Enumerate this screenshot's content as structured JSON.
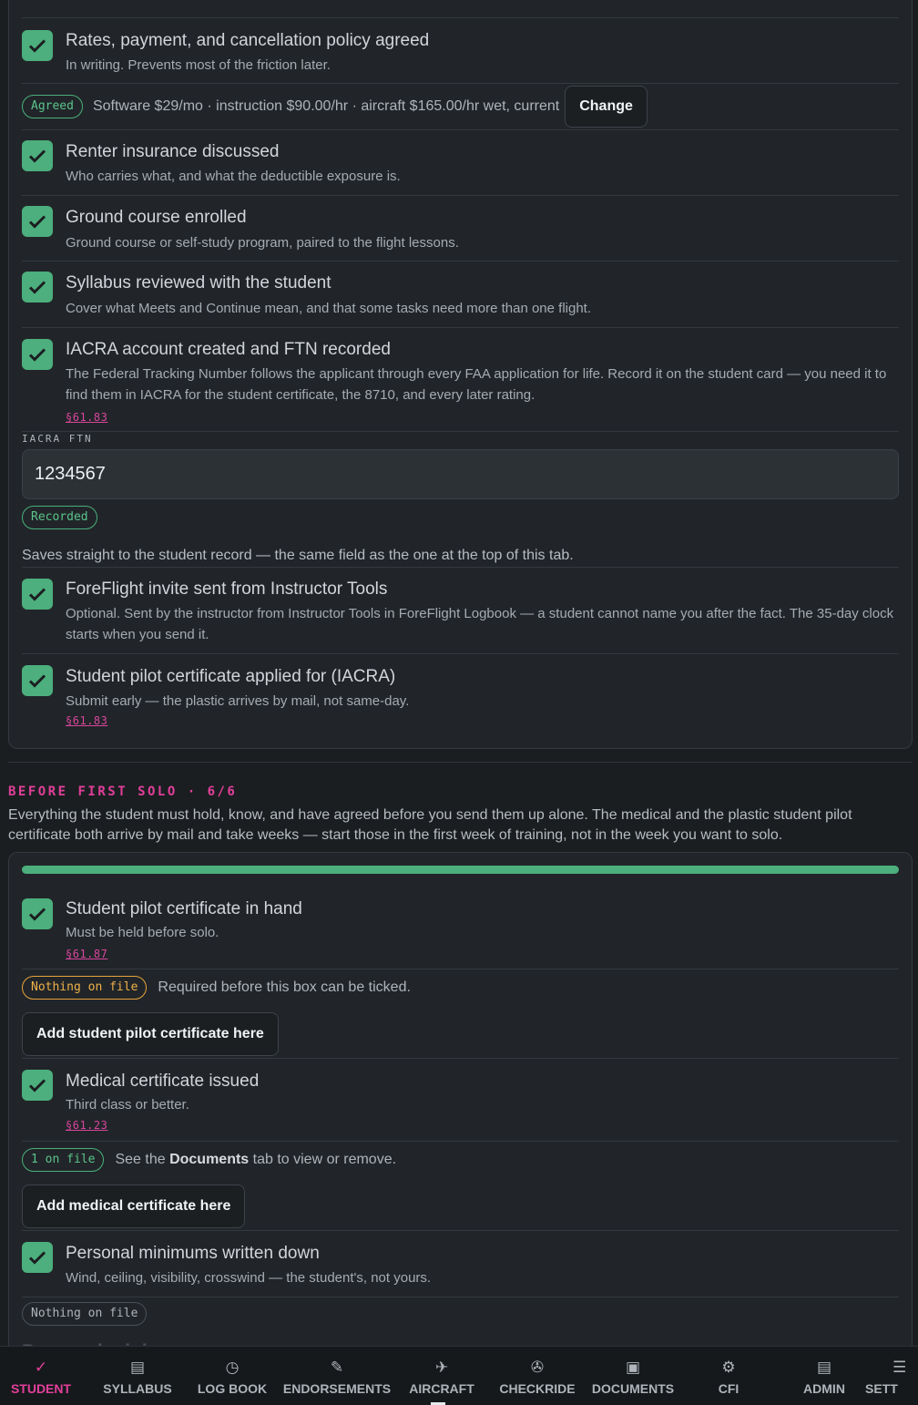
{
  "top_card": {
    "items": [
      {
        "title": "Rates, payment, and cancellation policy agreed",
        "desc": "In writing. Prevents most of the friction later."
      },
      {
        "title": "Renter insurance discussed",
        "desc": "Who carries what, and what the deductible exposure is."
      },
      {
        "title": "Ground course enrolled",
        "desc": "Ground course or self-study program, paired to the flight lessons."
      },
      {
        "title": "Syllabus reviewed with the student",
        "desc": "Cover what Meets and Continue mean, and that some tasks need more than one flight."
      },
      {
        "title": "IACRA account created and FTN recorded",
        "desc": "The Federal Tracking Number follows the applicant through every FAA application for life. Record it on the student card — you need it to find them in IACRA for the student certificate, the 8710, and every later rating.",
        "reg": "§61.83"
      },
      {
        "title": "ForeFlight invite sent from Instructor Tools",
        "desc": "Optional. Sent by the instructor from Instructor Tools in ForeFlight Logbook — a student cannot name you after the fact. The 35-day clock starts when you send it."
      },
      {
        "title": "Student pilot certificate applied for (IACRA)",
        "desc": "Submit early — the plastic arrives by mail, not same-day.",
        "reg": "§61.83"
      }
    ],
    "rates": {
      "badge": "Agreed",
      "text": "Software $29/mo · instruction $90.00/hr · aircraft $165.00/hr wet, current",
      "button": "Change"
    },
    "ftn": {
      "label": "IACRA FTN",
      "value": "1234567",
      "badge": "Recorded",
      "note": "Saves straight to the student record — the same field as the one at the top of this tab."
    }
  },
  "section": {
    "heading": "BEFORE FIRST SOLO · 6/6",
    "description": "Everything the student must hold, know, and have agreed before you send them up alone. The medical and the plastic student pilot certificate both arrive by mail and take weeks — start those in the first week of training, not in the week you want to solo.",
    "progress": 1.0,
    "items": [
      {
        "title": "Student pilot certificate in hand",
        "desc": "Must be held before solo.",
        "reg": "§61.87",
        "badge": "Nothing on file",
        "note": "Required before this box can be ticked.",
        "button": "Add student pilot certificate here"
      },
      {
        "title": "Medical certificate issued",
        "desc": "Third class or better.",
        "reg": "§61.23",
        "badge": "1 on file",
        "note_pre": "See the ",
        "note_bold": "Documents",
        "note_post": " tab to view or remove.",
        "button": "Add medical certificate here"
      },
      {
        "title": "Personal minimums written down",
        "desc": "Wind, ceiling, visibility, crosswind — the student's, not yours.",
        "badge": "Nothing on file",
        "partial": "Personal minimums"
      }
    ]
  },
  "tabs": [
    {
      "label": "STUDENT",
      "icon": "check-icon",
      "glyph": "✓",
      "active": true
    },
    {
      "label": "SYLLABUS",
      "icon": "list-icon",
      "glyph": "▤"
    },
    {
      "label": "LOG BOOK",
      "icon": "clock-icon",
      "glyph": "◷"
    },
    {
      "label": "ENDORSEMENTS",
      "icon": "pen-icon",
      "glyph": "✎"
    },
    {
      "label": "AIRCRAFT",
      "icon": "airplane-icon",
      "glyph": "✈"
    },
    {
      "label": "CHECKRIDE",
      "icon": "steering-icon",
      "glyph": "✇"
    },
    {
      "label": "DOCUMENTS",
      "icon": "document-icon",
      "glyph": "▣"
    },
    {
      "label": "CFI",
      "icon": "gear-icon",
      "glyph": "⚙"
    },
    {
      "label": "ADMIN",
      "icon": "list-icon",
      "glyph": "▤"
    },
    {
      "label": "SETT",
      "icon": "menu-icon",
      "glyph": "☰"
    }
  ],
  "colors": {
    "accent": "#e23f9a",
    "check": "#4caf7d",
    "warning": "#f0b14a"
  }
}
